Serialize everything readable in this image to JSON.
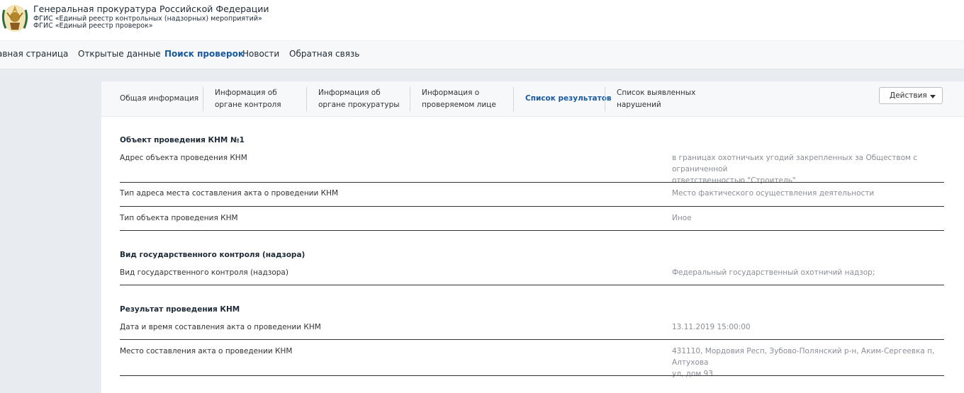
{
  "header": {
    "org_title": "Генеральная прокуратура Российской Федерации",
    "subtitle_1": "ФГИС «Единый реестр контрольных (надзорных) мероприятий»",
    "subtitle_2": "ФГИС «Единый реестр проверок»"
  },
  "nav": {
    "items": [
      {
        "label": "авная страница"
      },
      {
        "label": "Открытые данные"
      },
      {
        "label": "Поиск проверок"
      },
      {
        "label": "Новости"
      },
      {
        "label": "Обратная связь"
      }
    ]
  },
  "tabs": {
    "items": [
      {
        "label": "Общая информация"
      },
      {
        "line1": "Информация об",
        "line2": "органе контроля"
      },
      {
        "line1": "Информация об",
        "line2": "органе прокуратуры"
      },
      {
        "line1": "Информация о",
        "line2": "проверяемом лице"
      },
      {
        "label": "Список результатов"
      },
      {
        "line1": "Список выявленных",
        "line2": "нарушений"
      }
    ],
    "actions_label": "Действия"
  },
  "sections": [
    {
      "title": "Объект проведения КНМ №1",
      "rows": [
        {
          "label": "Адрес объекта проведения КНМ",
          "value_line1": "в границах охотничьих угодий закрепленных за Обществом с ограниченной",
          "value_line2": "ответственностью \"Строитель\""
        },
        {
          "label": "Тип адреса места составления акта о проведении КНМ",
          "value": "Место фактического осуществления деятельности"
        },
        {
          "label": "Тип объекта проведения КНМ",
          "value": "Иное"
        }
      ]
    },
    {
      "title": "Вид государственного контроля (надзора)",
      "rows": [
        {
          "label": "Вид государственного контроля (надзора)",
          "value": "Федеральный государственный охотничий надзор;"
        }
      ]
    },
    {
      "title": "Результат проведения КНМ",
      "rows": [
        {
          "label": "Дата и время составления акта о проведении КНМ",
          "value": "13.11.2019 15:00:00"
        },
        {
          "label": "Место составления акта о проведении КНМ",
          "value_line1": "431110, Мордовия Респ, Зубово-Полянский р-н, Аким-Сергеевка п, Алтухова",
          "value_line2": "ул, дом 93"
        }
      ]
    }
  ],
  "colors": {
    "accent": "#1a5a9c",
    "page_bg": "#e8ebef",
    "value_text": "#8a8f96"
  }
}
